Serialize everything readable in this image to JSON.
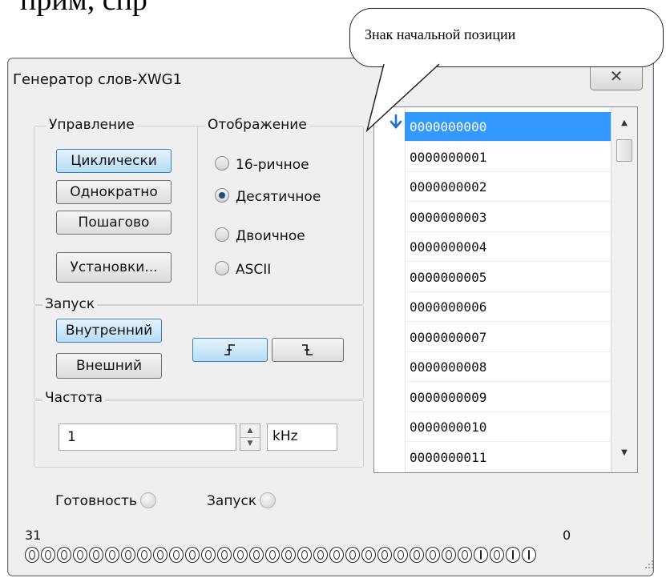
{
  "heading_fragment": "прим, спр",
  "callout": {
    "text": "Знак начальной позиции"
  },
  "window": {
    "title": "Генератор слов-XWG1",
    "close_icon": "close-icon",
    "close_glyph": "✕"
  },
  "control": {
    "legend": "Управление",
    "buttons": [
      "Циклически",
      "Однократно",
      "Пошагово",
      "Установки..."
    ],
    "active": "Циклически"
  },
  "display": {
    "legend": "Отображение",
    "options": [
      "16-ричное",
      "Десятичное",
      "Двоичное",
      "ASCII"
    ],
    "selected": "Десятичное"
  },
  "trigger": {
    "legend": "Запуск",
    "buttons": [
      "Внутренний",
      "Внешний"
    ],
    "active": "Внутренний",
    "edge_buttons": {
      "rising_icon": "rising-edge-icon",
      "falling_icon": "falling-edge-icon",
      "active": "rising"
    }
  },
  "frequency": {
    "legend": "Частота",
    "value": "1",
    "unit": "kHz"
  },
  "status": {
    "ready_label": "Готовность",
    "trigger_label": "Запуск"
  },
  "bits": {
    "msb_label": "31",
    "lsb_label": "0",
    "pattern": "00000000000000000000000000001011"
  },
  "word_list": {
    "start_marker_icon": "start-position-icon",
    "rows": [
      "0000000000",
      "0000000001",
      "0000000002",
      "0000000003",
      "0000000004",
      "0000000005",
      "0000000006",
      "0000000007",
      "0000000008",
      "0000000009",
      "0000000010",
      "0000000011"
    ],
    "selected_index": 0
  },
  "colors": {
    "selection": "#3399ff",
    "active_button": "#b7dcf5",
    "window_bg": "#efefef"
  }
}
